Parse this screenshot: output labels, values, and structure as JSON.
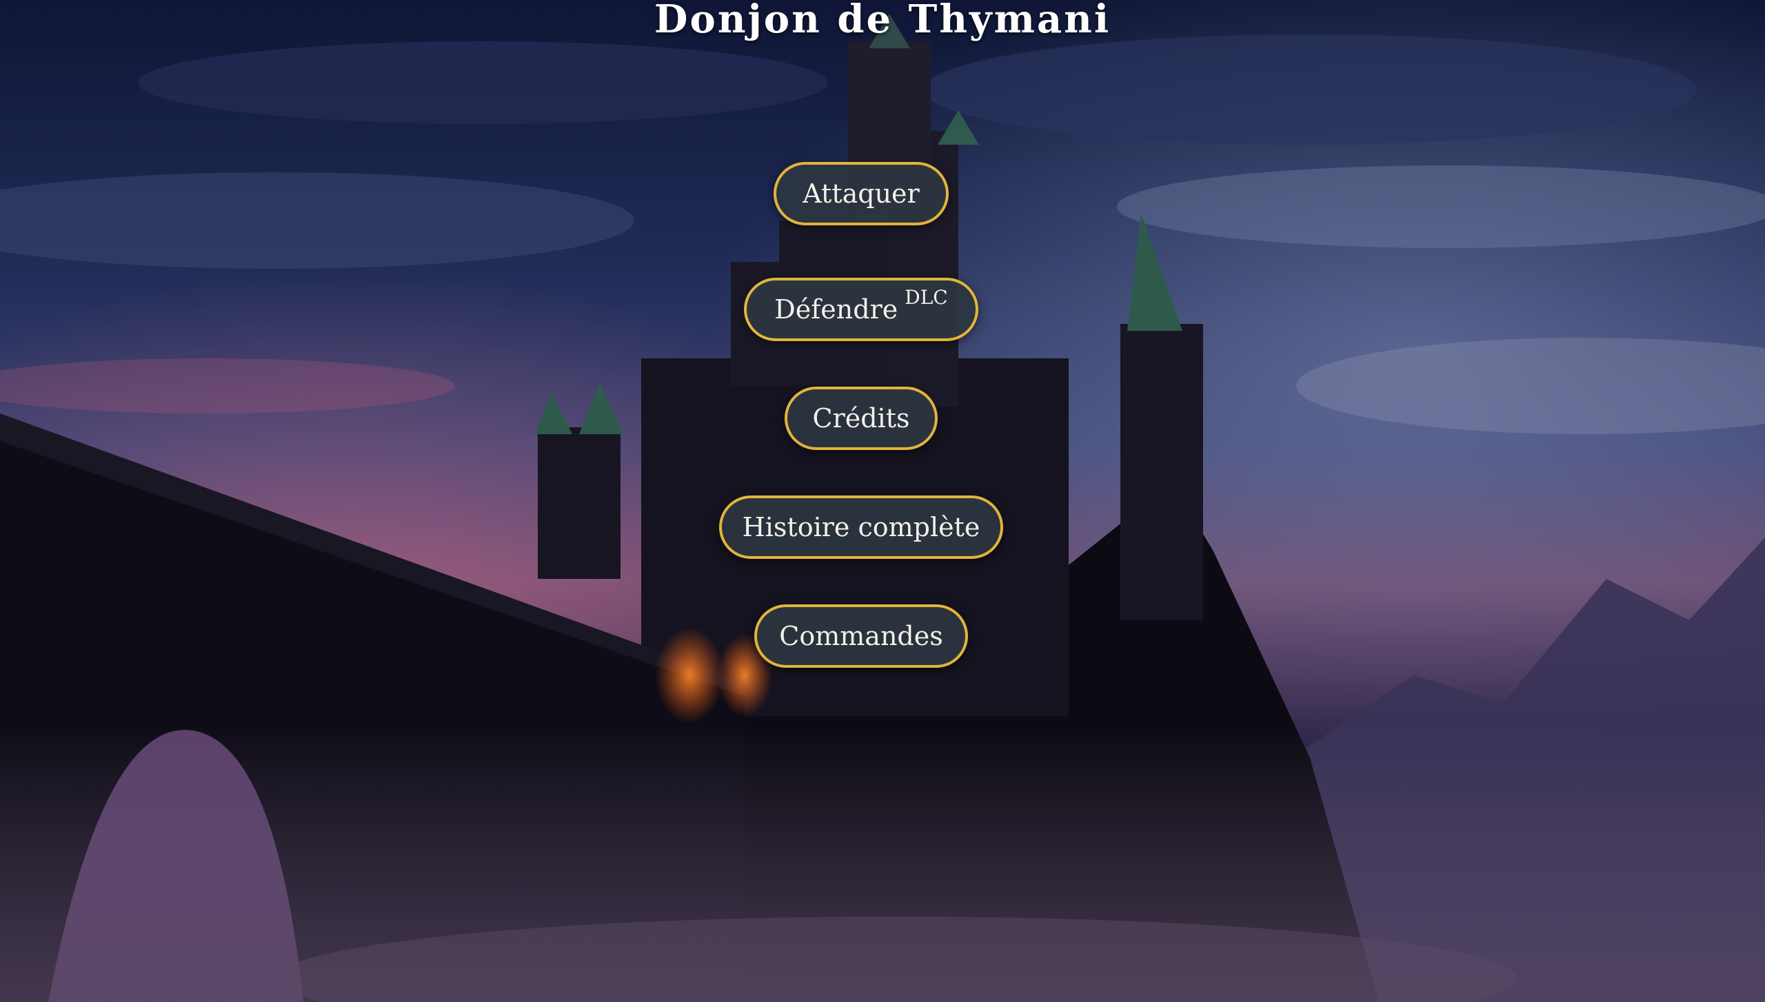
{
  "title": "Donjon de Thymani",
  "menu": {
    "attack_label": "Attaquer",
    "defend_label": "Défendre",
    "defend_badge": "DLC",
    "credits_label": "Crédits",
    "story_label": "Histoire complète",
    "controls_label": "Commandes"
  },
  "colors": {
    "button_border": "#e2b43c",
    "button_fill": "#2c3640",
    "button_text": "#f4f1ea",
    "title_text": "#ffffff"
  }
}
